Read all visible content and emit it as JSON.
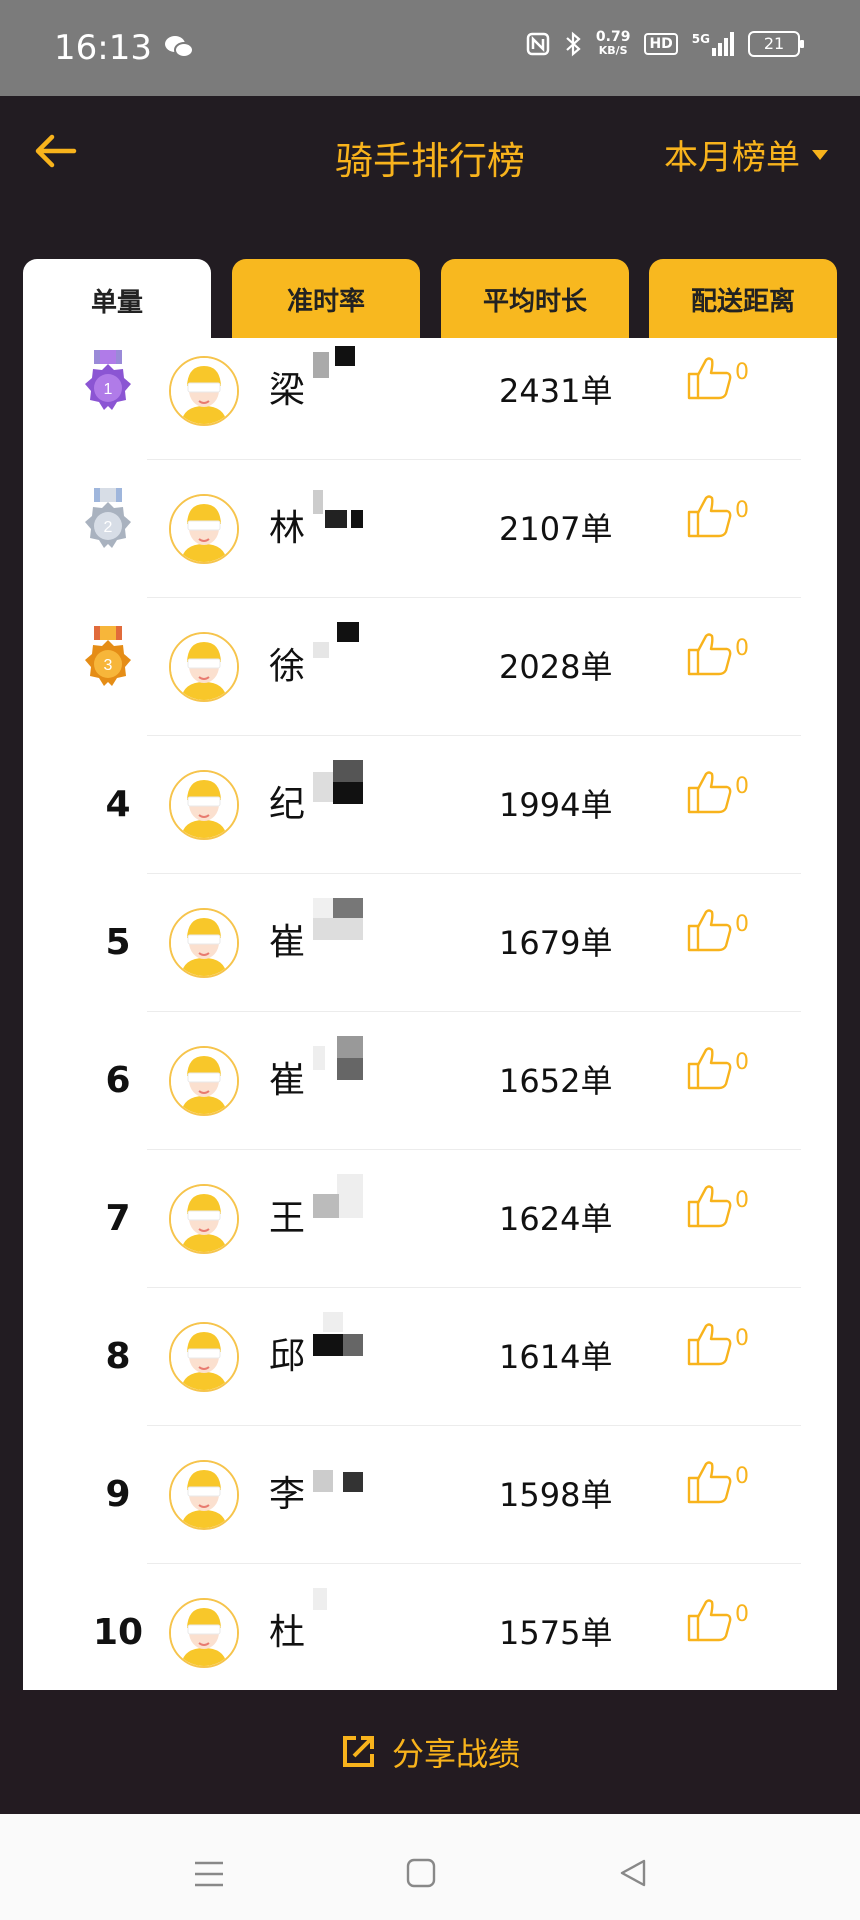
{
  "status_bar": {
    "time": "16:13",
    "net_speed_value": "0.79",
    "net_speed_unit": "KB/S",
    "hd": "HD",
    "network": "5G",
    "battery": "21"
  },
  "header": {
    "title": "骑手排行榜",
    "period": "本月榜单"
  },
  "tabs": [
    "单量",
    "准时率",
    "平均时长",
    "配送距离"
  ],
  "active_tab": "单量",
  "colors": {
    "accent": "#f8b31c",
    "tab_bg": "#f8b81f",
    "dark_bg": "#221c22"
  },
  "rows": [
    {
      "rank": "1",
      "name": "梁",
      "orders": "2431单",
      "likes": "0",
      "badge": "medal-purple"
    },
    {
      "rank": "2",
      "name": "林",
      "orders": "2107单",
      "likes": "0",
      "badge": "medal-silver"
    },
    {
      "rank": "3",
      "name": "徐",
      "orders": "2028单",
      "likes": "0",
      "badge": "medal-bronze"
    },
    {
      "rank": "4",
      "name": "纪",
      "orders": "1994单",
      "likes": "0"
    },
    {
      "rank": "5",
      "name": "崔",
      "orders": "1679单",
      "likes": "0"
    },
    {
      "rank": "6",
      "name": "崔",
      "orders": "1652单",
      "likes": "0"
    },
    {
      "rank": "7",
      "name": "王",
      "orders": "1624单",
      "likes": "0"
    },
    {
      "rank": "8",
      "name": "邱",
      "orders": "1614单",
      "likes": "0"
    },
    {
      "rank": "9",
      "name": "李",
      "orders": "1598单",
      "likes": "0"
    },
    {
      "rank": "10",
      "name": "杜",
      "orders": "1575单",
      "likes": "0"
    }
  ],
  "share": {
    "label": "分享战绩"
  },
  "icons": [
    "back-arrow-icon",
    "caret-down-icon",
    "medal-icon",
    "avatar-icon",
    "thumbs-up-icon",
    "share-icon",
    "menu-icon",
    "home-icon",
    "back-triangle-icon"
  ]
}
